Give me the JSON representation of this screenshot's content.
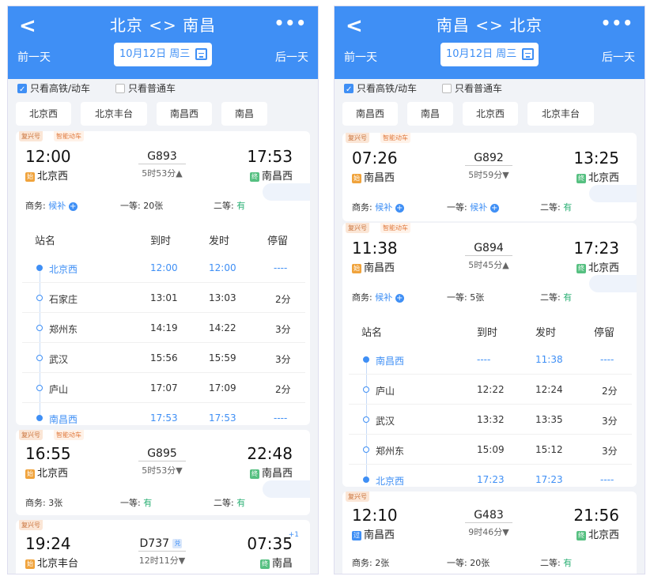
{
  "panels": [
    {
      "title": "北京 <> 南昌",
      "prev": "前一天",
      "next": "后一天",
      "date": "10月12日 周三",
      "filter_high_speed": "只看高铁/动车",
      "filter_normal": "只看普通车",
      "stations": [
        "北京西",
        "北京丰台",
        "南昌西",
        "南昌"
      ],
      "header_cols": {
        "name": "站名",
        "arrive": "到时",
        "depart": "发时",
        "stop": "停留"
      },
      "trains": [
        {
          "tag1": "复兴号",
          "tag2": "智能动车",
          "dep": "12:00",
          "dep_icon": "始",
          "dep_station": "北京西",
          "no": "G893",
          "duration": "5时53分▲",
          "arr": "17:53",
          "arr_icon": "终",
          "arr_station": "南昌西",
          "plus": "",
          "s1_label": "商务:",
          "s1_val": "候补",
          "s2_label": "一等:",
          "s2_val": "20张",
          "s3_label": "二等:",
          "s3_val": "有"
        },
        {
          "tag1": "复兴号",
          "tag2": "智能动车",
          "dep": "16:55",
          "dep_icon": "始",
          "dep_station": "北京西",
          "no": "G895",
          "duration": "5时53分▼",
          "arr": "22:48",
          "arr_icon": "终",
          "arr_station": "南昌西",
          "plus": "",
          "s1_label": "商务:",
          "s1_val": "3张",
          "s2_label": "一等:",
          "s2_val": "有",
          "s3_label": "二等:",
          "s3_val": "有"
        },
        {
          "tag1": "复兴号",
          "tag2": "",
          "dep": "19:24",
          "dep_icon": "始",
          "dep_station": "北京丰台",
          "no": "D737",
          "no_badge": "兑",
          "duration": "12时11分▼",
          "arr": "07:35",
          "arr_icon": "终",
          "arr_station": "南昌",
          "plus": "+1"
        }
      ],
      "stops": [
        {
          "name": "北京西",
          "arrive": "12:00",
          "depart": "12:00",
          "stop": "----"
        },
        {
          "name": "石家庄",
          "arrive": "13:01",
          "depart": "13:03",
          "stop": "2分"
        },
        {
          "name": "郑州东",
          "arrive": "14:19",
          "depart": "14:22",
          "stop": "3分"
        },
        {
          "name": "武汉",
          "arrive": "15:56",
          "depart": "15:59",
          "stop": "3分"
        },
        {
          "name": "庐山",
          "arrive": "17:07",
          "depart": "17:09",
          "stop": "2分"
        },
        {
          "name": "南昌西",
          "arrive": "17:53",
          "depart": "17:53",
          "stop": "----"
        }
      ]
    },
    {
      "title": "南昌 <> 北京",
      "prev": "前一天",
      "next": "后一天",
      "date": "10月12日 周三",
      "filter_high_speed": "只看高铁/动车",
      "filter_normal": "只看普通车",
      "stations": [
        "南昌西",
        "南昌",
        "北京西",
        "北京丰台"
      ],
      "header_cols": {
        "name": "站名",
        "arrive": "到时",
        "depart": "发时",
        "stop": "停留"
      },
      "trains": [
        {
          "tag1": "复兴号",
          "tag2": "智能动车",
          "dep": "07:26",
          "dep_icon": "始",
          "dep_station": "南昌西",
          "no": "G892",
          "duration": "5时59分▼",
          "arr": "13:25",
          "arr_icon": "终",
          "arr_station": "北京西",
          "plus": "",
          "s1_label": "商务:",
          "s1_val": "候补",
          "s2_label": "一等:",
          "s2_val": "候补",
          "s3_label": "二等:",
          "s3_val": "有"
        },
        {
          "tag1": "复兴号",
          "tag2": "智能动车",
          "dep": "11:38",
          "dep_icon": "始",
          "dep_station": "南昌西",
          "no": "G894",
          "duration": "5时45分▲",
          "arr": "17:23",
          "arr_icon": "终",
          "arr_station": "北京西",
          "plus": "",
          "s1_label": "商务:",
          "s1_val": "候补",
          "s2_label": "一等:",
          "s2_val": "5张",
          "s3_label": "二等:",
          "s3_val": "有"
        },
        {
          "tag1": "复兴号",
          "tag2": "",
          "dep": "12:10",
          "dep_icon": "过",
          "dep_station": "南昌西",
          "no": "G483",
          "duration": "9时46分▼",
          "arr": "21:56",
          "arr_icon": "终",
          "arr_station": "北京西",
          "plus": "",
          "s1_label": "商务:",
          "s1_val": "2张",
          "s2_label": "一等:",
          "s2_val": "20张",
          "s3_label": "二等:",
          "s3_val": "有"
        }
      ],
      "stops": [
        {
          "name": "南昌西",
          "arrive": "----",
          "depart": "11:38",
          "stop": "----"
        },
        {
          "name": "庐山",
          "arrive": "12:22",
          "depart": "12:24",
          "stop": "2分"
        },
        {
          "name": "武汉",
          "arrive": "13:32",
          "depart": "13:35",
          "stop": "3分"
        },
        {
          "name": "郑州东",
          "arrive": "15:09",
          "depart": "15:12",
          "stop": "3分"
        },
        {
          "name": "北京西",
          "arrive": "17:23",
          "depart": "17:23",
          "stop": "----"
        }
      ]
    }
  ],
  "colors": {
    "accent": "#3f8ff5",
    "available": "#2bb074",
    "tag": "#c9723a"
  }
}
